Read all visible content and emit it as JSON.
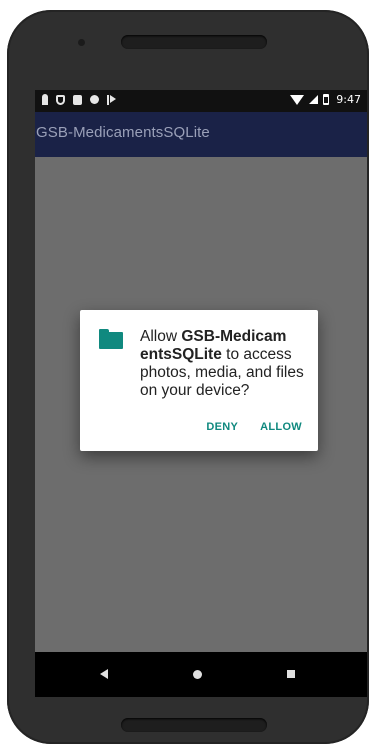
{
  "status_bar": {
    "time": "9:47",
    "icons_left": [
      "person-icon",
      "shield-icon",
      "sd-card-icon",
      "circle-icon",
      "flag-icon"
    ],
    "icons_right": [
      "wifi-icon",
      "signal-icon",
      "battery-icon"
    ]
  },
  "app_bar": {
    "title": "GSB-MedicamentsSQLite"
  },
  "dialog": {
    "icon": "folder-icon",
    "message_prefix": "Allow ",
    "app_name": "GSB-Medicam entsSQLite",
    "message_suffix": " to access photos, media, and files on your device?",
    "deny_label": "DENY",
    "allow_label": "ALLOW"
  },
  "nav_bar": {
    "icons": [
      "back-icon",
      "home-icon",
      "recents-icon"
    ]
  },
  "colors": {
    "app_bar": "#1a2247",
    "accent": "#10897f",
    "scrim": "#6d6d6d"
  }
}
